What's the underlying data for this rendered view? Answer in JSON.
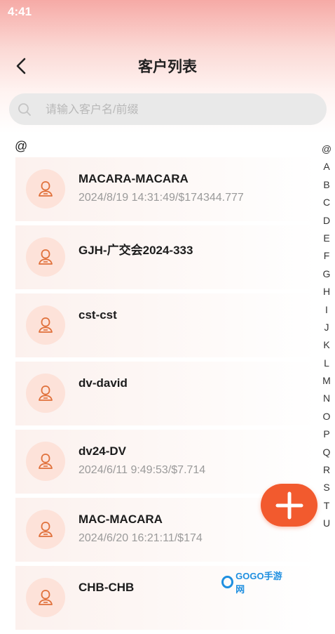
{
  "status_bar": {
    "time": "4:41"
  },
  "header": {
    "title": "客户列表"
  },
  "search": {
    "placeholder": "请输入客户名/前缀"
  },
  "section": {
    "letter": "@"
  },
  "customers": [
    {
      "name": "MACARA-MACARA",
      "detail": "2024/8/19 14:31:49/$174344.777"
    },
    {
      "name": "GJH-广交会2024-333",
      "detail": ""
    },
    {
      "name": "cst-cst",
      "detail": ""
    },
    {
      "name": "dv-david",
      "detail": ""
    },
    {
      "name": "dv24-DV",
      "detail": "2024/6/11 9:49:53/$7.714"
    },
    {
      "name": "MAC-MACARA",
      "detail": "2024/6/20 16:21:11/$174"
    },
    {
      "name": "CHB-CHB",
      "detail": ""
    }
  ],
  "alphabet_index": [
    "@",
    "A",
    "B",
    "C",
    "D",
    "E",
    "F",
    "G",
    "H",
    "I",
    "J",
    "K",
    "L",
    "M",
    "N",
    "O",
    "P",
    "Q",
    "R",
    "S",
    "T",
    "U"
  ],
  "watermark": {
    "text": "GOGO手游网"
  },
  "colors": {
    "accent": "#f25a2e",
    "avatar_bg": "#fde2d9",
    "avatar_icon": "#e0703a"
  }
}
